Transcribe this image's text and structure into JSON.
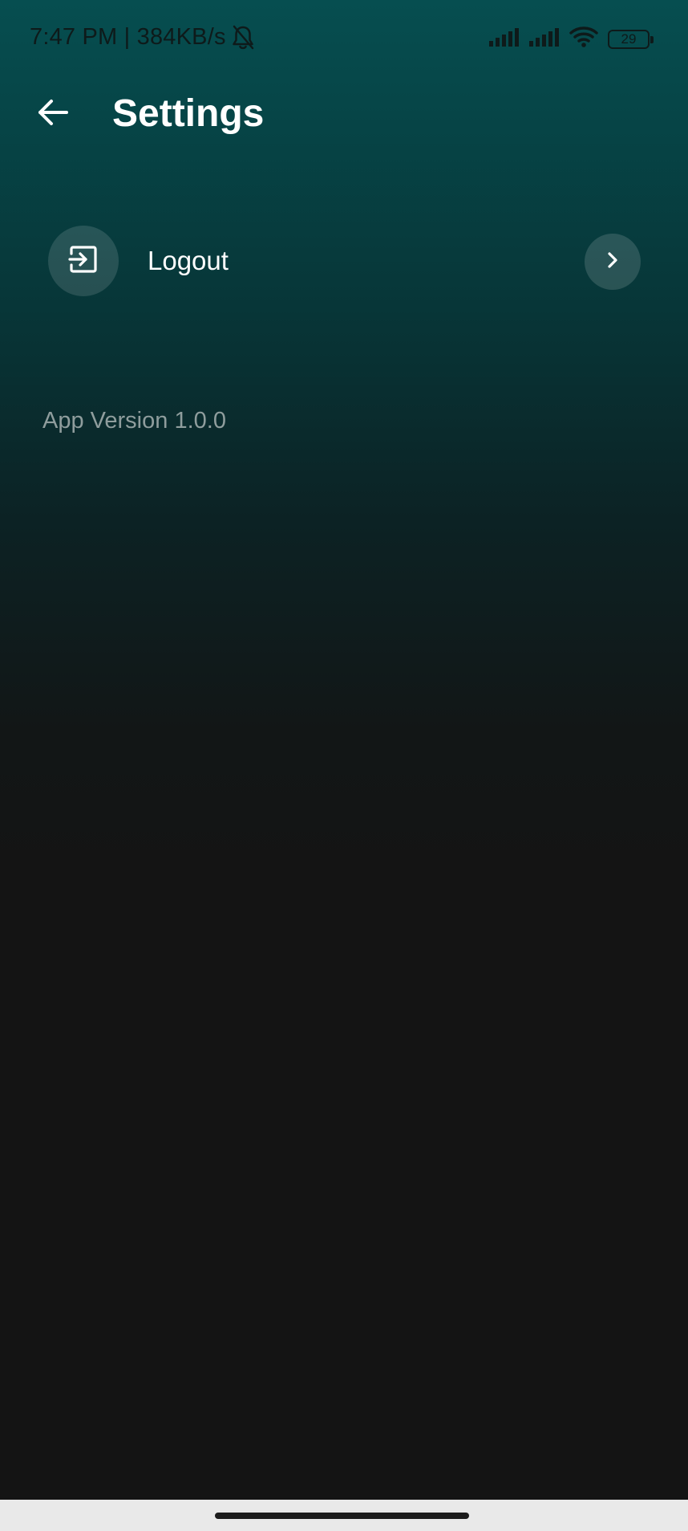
{
  "status_bar": {
    "time_and_speed": "7:47 PM | 384KB/s",
    "battery_level": "29",
    "icons": [
      "bell-off-icon",
      "signal-icon",
      "signal-icon",
      "wifi-icon",
      "battery-icon"
    ]
  },
  "app_bar": {
    "title": "Settings",
    "back_icon": "arrow-left-icon"
  },
  "settings": {
    "items": [
      {
        "label": "Logout",
        "icon": "logout-icon",
        "trailing_icon": "chevron-right-icon"
      }
    ]
  },
  "footer": {
    "app_version": "App Version 1.0.0"
  },
  "colors": {
    "gradient_top": "#064e50",
    "background": "#141414",
    "text_primary": "#ffffff",
    "text_secondary": "#8f9d9d",
    "nav_bar": "#e9e9e9"
  }
}
